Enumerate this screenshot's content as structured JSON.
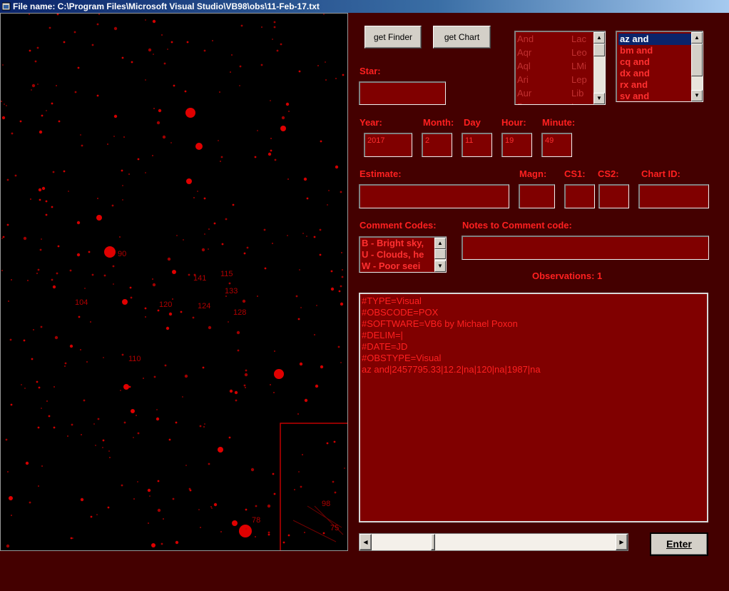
{
  "window": {
    "title": "File name: C:\\Program Files\\Microsoft Visual Studio\\VB98\\obs\\11-Feb-17.txt"
  },
  "buttons": {
    "get_finder": "get Finder",
    "get_chart": "get Chart",
    "enter": "Enter"
  },
  "labels": {
    "star": "Star:",
    "year": "Year:",
    "month": "Month:",
    "day": "Day",
    "hour": "Hour:",
    "minute": "Minute:",
    "estimate": "Estimate:",
    "magn": "Magn:",
    "cs1": "CS1:",
    "cs2": "CS2:",
    "chart_id": "Chart ID:",
    "comment_codes": "Comment Codes:",
    "notes": "Notes to Comment code:",
    "observations": "Observations: 1"
  },
  "fields": {
    "star": "",
    "year": "2017",
    "month": "2",
    "day": "11",
    "hour": "19",
    "minute": "49",
    "estimate": "",
    "magn": "",
    "cs1": "",
    "cs2": "",
    "chart_id": "",
    "notes": ""
  },
  "constellations": {
    "col1": [
      "And",
      "Aqr",
      "Aql",
      "Ari",
      "Aur",
      "Boo"
    ],
    "col2": [
      "Lac",
      "Leo",
      "LMi",
      "Lep",
      "Lib",
      "Lup"
    ]
  },
  "stars_list": {
    "items": [
      "az and",
      "bm and",
      "cq and",
      "dx and",
      "rx and",
      "sv and"
    ],
    "selected": "az and"
  },
  "comment_codes": [
    "B - Bright sky,",
    "U - Clouds, he",
    "W - Poor seei"
  ],
  "log_lines": [
    "#TYPE=Visual",
    "#OBSCODE=POX",
    "#SOFTWARE=VB6 by Michael Poxon",
    "#DELIM=|",
    "#DATE=JD",
    "#OBSTYPE=Visual",
    "az and|2457795.33|12.2|na|120|na|1987|na"
  ],
  "chart_labels": [
    "90",
    "141",
    "115",
    "133",
    "104",
    "120",
    "124",
    "128",
    "110",
    "98",
    "78",
    "75"
  ],
  "colors": {
    "background": "#440000",
    "field": "#800000",
    "text": "#ff2020",
    "star": "#e00000"
  }
}
